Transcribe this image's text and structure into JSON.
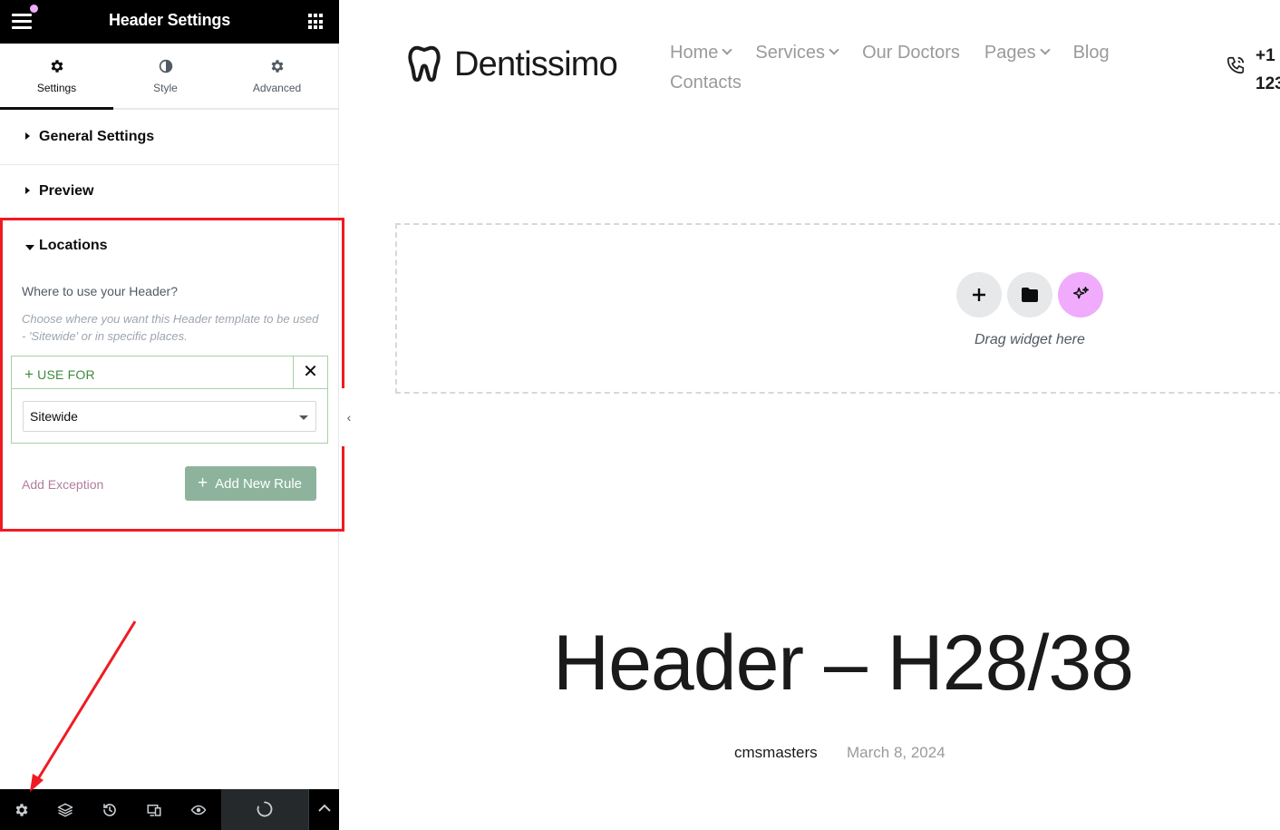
{
  "panel": {
    "title": "Header Settings",
    "tabs": [
      {
        "label": "Settings",
        "icon": "gear-icon",
        "active": true
      },
      {
        "label": "Style",
        "icon": "contrast-icon",
        "active": false
      },
      {
        "label": "Advanced",
        "icon": "gear-icon",
        "active": false
      }
    ],
    "sections": {
      "general": "General Settings",
      "preview": "Preview",
      "locations": "Locations"
    },
    "locations": {
      "question": "Where to use your Header?",
      "description": "Choose where you want this Header template to be used - 'Sitewide' or in specific places.",
      "rule_label": "USE FOR",
      "select_value": "Sitewide",
      "add_exception": "Add Exception",
      "add_new_rule": "Add New Rule"
    },
    "bottom_icons": [
      "settings-icon",
      "layers-icon",
      "history-icon",
      "responsive-icon",
      "preview-eye-icon",
      "loading-icon",
      "chevron-up-icon"
    ],
    "highlight_color": "#ef1b23"
  },
  "site": {
    "logo_text": "Dentissimo",
    "nav": [
      "Home",
      "Services",
      "Our Doctors",
      "Pages",
      "Blog",
      "Contacts"
    ],
    "phone_partial_1": "+1",
    "phone_partial_2": "123",
    "drag_hint": "Drag widget here",
    "heading": "Header – H28/38",
    "author": "cmsmasters",
    "date": "March 8, 2024"
  }
}
